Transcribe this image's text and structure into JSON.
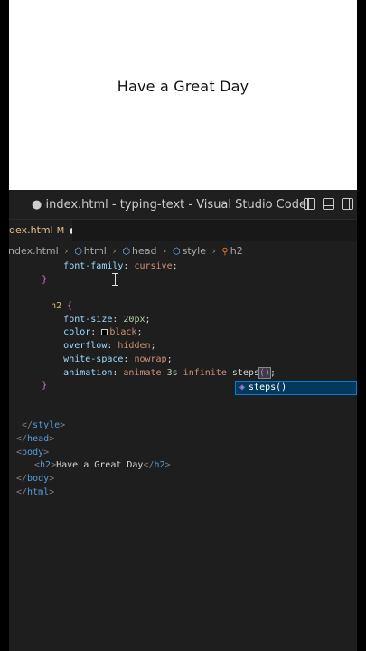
{
  "preview": {
    "heading": "Have a Great Day"
  },
  "window": {
    "dirty_marker": "●",
    "title": "index.html - typing-text - Visual Studio Code"
  },
  "tab": {
    "name": "index.html",
    "status": "M"
  },
  "breadcrumb": {
    "items": [
      "index.html",
      "html",
      "head",
      "style",
      "h2"
    ]
  },
  "code_lines": [
    "        font-family: cursive;",
    "    }",
    "",
    "    h2 {",
    "        font-size: 20px;",
    "        color: black;",
    "        overflow: hidden;",
    "        white-space: nowrap;",
    "        animation: animate 3s infinite steps();",
    "    }",
    "",
    "",
    "    </style>",
    "</head>",
    "<body>",
    "    <h2>Have a Great Day</h2>",
    "</body>",
    "</html>"
  ],
  "autocomplete": {
    "suggestion": "steps()",
    "icon": "cube-icon"
  },
  "colors": {
    "editor_bg": "#1e1e1e",
    "selector": "#d7ba7d",
    "property": "#9cdcfe",
    "value": "#ce9178",
    "number": "#b5cea8",
    "tag": "#569cd6",
    "suggest_bg": "#04395e"
  }
}
